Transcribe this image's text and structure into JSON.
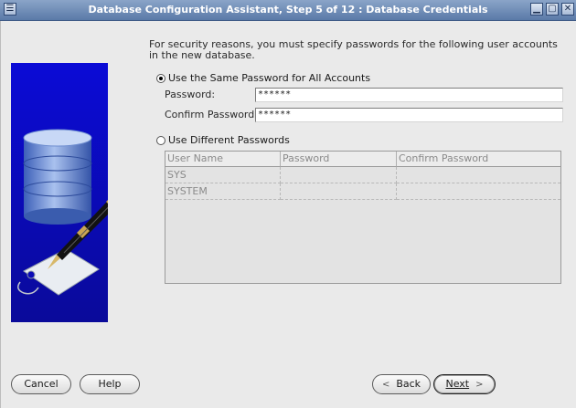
{
  "window": {
    "title": "Database Configuration Assistant, Step 5 of 12 : Database Credentials",
    "controls": [
      "minimize-icon",
      "maximize-icon",
      "close-icon"
    ]
  },
  "intro_text": "For security reasons, you must specify passwords for the following user accounts in the new database.",
  "same_password": {
    "radio_label": "Use the Same Password for All Accounts",
    "selected": true,
    "password_label": "Password:",
    "password_value": "******",
    "confirm_label": "Confirm Password:",
    "confirm_value": "******"
  },
  "different_passwords": {
    "radio_label": "Use Different Passwords",
    "selected": false,
    "columns": [
      "User Name",
      "Password",
      "Confirm Password"
    ],
    "rows": [
      {
        "user": "SYS",
        "password": "",
        "confirm": ""
      },
      {
        "user": "SYSTEM",
        "password": "",
        "confirm": ""
      }
    ]
  },
  "buttons": {
    "cancel": "Cancel",
    "help": "Help",
    "back": "Back",
    "next": "Next"
  },
  "colors": {
    "title_bar": "#6a88b6",
    "art_background": "#1010c8"
  }
}
